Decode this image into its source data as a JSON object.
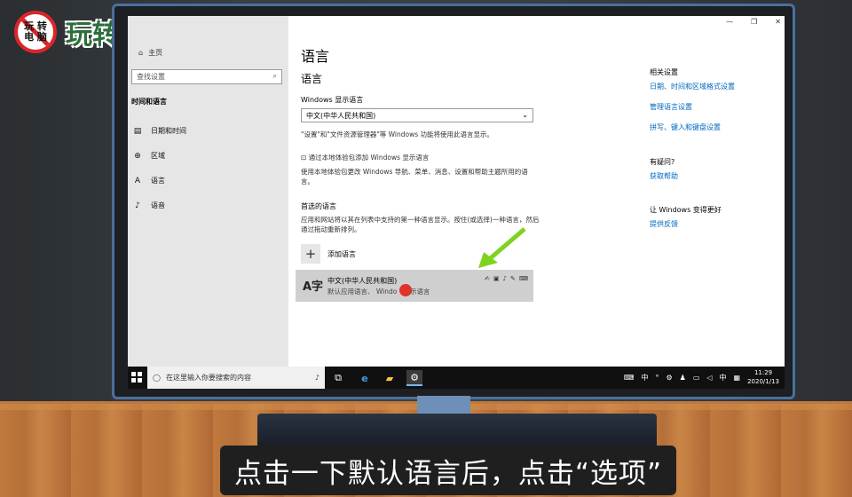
{
  "logo": {
    "badge_line1": "玩 转",
    "badge_line2": "电 脑",
    "text": "玩转电脑"
  },
  "sidebar": {
    "home_label": "主页",
    "search_placeholder": "查找设置",
    "section_title": "时间和语言",
    "items": [
      {
        "label": "日期和时间",
        "icon": "calendar-icon"
      },
      {
        "label": "区域",
        "icon": "globe-icon"
      },
      {
        "label": "语言",
        "icon": "language-icon"
      },
      {
        "label": "语音",
        "icon": "microphone-icon"
      }
    ]
  },
  "main": {
    "page_title": "语言",
    "section_title": "语言",
    "display_language_label": "Windows 显示语言",
    "display_language_value": "中文(中华人民共和国)",
    "display_language_note": "\"设置\"和\"文件资源管理器\"等 Windows 功能将使用此语言显示。",
    "add_display_lang_link": "通过本地体验包添加 Windows 显示语言",
    "add_display_lang_note": "使用本地体验包更改 Windows 导航、菜单、消息、设置和帮助主题所用的语言。",
    "preferred_title": "首选的语言",
    "preferred_note": "应用和网站将以其在列表中支持的第一种语言显示。按住(或选择)一种语言，然后通过拖动重新排列。",
    "add_language_label": "添加语言",
    "language_entry": {
      "name": "中文(中华人民共和国)",
      "sub_left": "默认应用语言、",
      "sub_mid": "Windo",
      "sub_right": "显示语言"
    }
  },
  "right_col": {
    "related_title": "相关设置",
    "related_links": [
      "日期、时间和区域格式设置",
      "管理语言设置",
      "拼写、键入和键盘设置"
    ],
    "help_title": "有疑问?",
    "help_link": "获取帮助",
    "better_title": "让 Windows 变得更好",
    "feedback_link": "提供反馈"
  },
  "taskbar": {
    "search_placeholder": "在这里输入你要搜索的内容",
    "ime": "中",
    "time": "11:29",
    "date": "2020/1/13"
  },
  "subtitle": "点击一下默认语言后，点击“选项”"
}
